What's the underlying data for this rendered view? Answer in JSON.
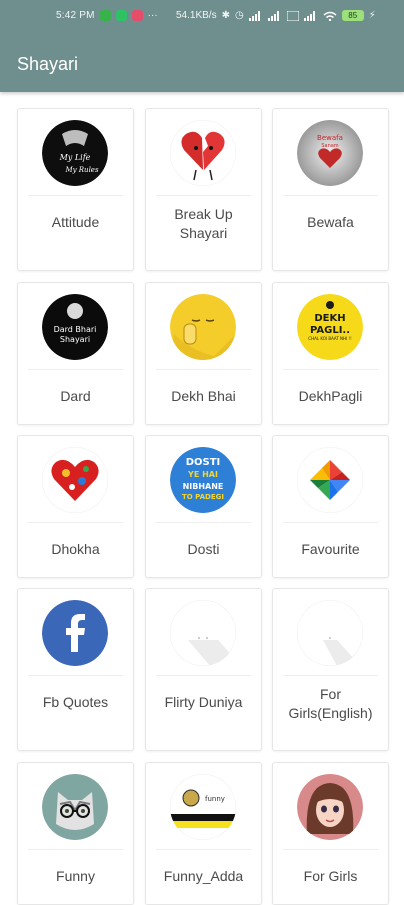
{
  "status_bar": {
    "time": "5:42 PM",
    "speed": "54.1KB/s",
    "battery": "85",
    "more": "···"
  },
  "app_bar": {
    "title": "Shayari"
  },
  "icon_text": {
    "my_life": "My Life",
    "my_rules": "My Rules",
    "bewafa_top": "Bewafa",
    "bewafa_sub": "Sanam",
    "dard_1": "Dard Bhari",
    "dard_2": "Shayari",
    "dekh_1": "DEKH",
    "dekh_2": "PAGLI..",
    "dekh_3": "CHAL KOI BAAT NHI !!",
    "dosti_1": "DOSTI",
    "dosti_2": "YE HAI",
    "dosti_3": "NIBHANE",
    "dosti_4": "TO PADEGI",
    "funny_adda": "funny"
  },
  "categories": [
    {
      "label": "Attitude",
      "icon": "attitude-icon"
    },
    {
      "label": "Break Up Shayari",
      "icon": "broken-heart-icon"
    },
    {
      "label": "Bewafa",
      "icon": "bewafa-icon"
    },
    {
      "label": "Dard",
      "icon": "dard-icon"
    },
    {
      "label": "Dekh Bhai",
      "icon": "dekh-bhai-emoji-icon"
    },
    {
      "label": "DekhPagli",
      "icon": "dekh-pagli-icon"
    },
    {
      "label": "Dhokha",
      "icon": "dhokha-heart-icon"
    },
    {
      "label": "Dosti",
      "icon": "dosti-icon"
    },
    {
      "label": "Favourite",
      "icon": "pinwheel-icon"
    },
    {
      "label": "Fb Quotes",
      "icon": "facebook-icon"
    },
    {
      "label": "Flirty Duniya",
      "icon": "placeholder-icon"
    },
    {
      "label": "For Girls(English)",
      "icon": "placeholder-icon"
    },
    {
      "label": "Funny",
      "icon": "cat-icon"
    },
    {
      "label": "Funny_Adda",
      "icon": "funny-adda-icon"
    },
    {
      "label": "For Girls",
      "icon": "girl-portrait-icon"
    }
  ],
  "colors": {
    "app_bar": "#6f8f8e",
    "card_border": "#e6e6e6",
    "label_text": "#4a4a4a"
  }
}
